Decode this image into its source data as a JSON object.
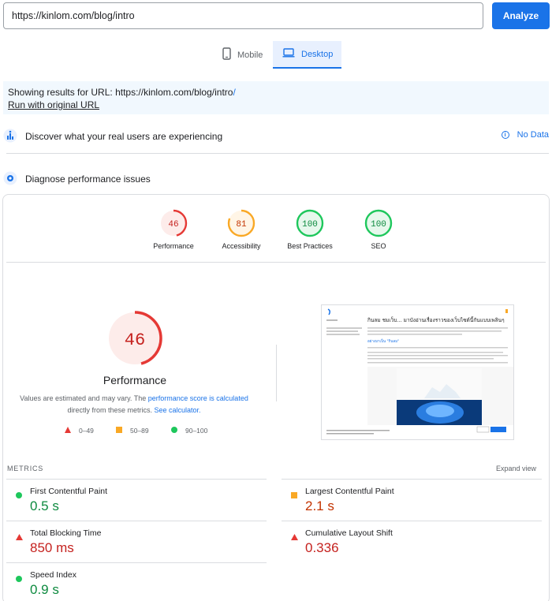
{
  "search": {
    "url": "https://kinlom.com/blog/intro",
    "analyze_label": "Analyze"
  },
  "tabs": [
    {
      "label": "Mobile",
      "icon": "phone-icon"
    },
    {
      "label": "Desktop",
      "icon": "laptop-icon",
      "selected": true
    }
  ],
  "notice": {
    "showing_prefix": "Showing results for URL: ",
    "url": "https://kinlom.com/blog/intro",
    "suffix": "/",
    "original_link": "Run with original URL"
  },
  "sections": {
    "real_users": {
      "label": "Discover what your real users are experiencing",
      "no_data": "No Data"
    },
    "diagnose": {
      "label": "Diagnose performance issues"
    }
  },
  "categories": [
    {
      "name": "Performance",
      "score": "46",
      "status": "bad"
    },
    {
      "name": "Accessibility",
      "score": "81",
      "status": "average"
    },
    {
      "name": "Best Practices",
      "score": "100",
      "status": "good"
    },
    {
      "name": "SEO",
      "score": "100",
      "status": "good"
    }
  ],
  "performance": {
    "score": "46",
    "title": "Performance",
    "estimate_text_1": "Values are estimated and may vary. The ",
    "estimate_link_1": "performance score is calculated",
    "estimate_text_2": "directly from these metrics. ",
    "estimate_link_2": "See calculator."
  },
  "legend": [
    {
      "range": "0–49",
      "shape": "triangle",
      "color": "#e53935"
    },
    {
      "range": "50–89",
      "shape": "square",
      "color": "#f9a825"
    },
    {
      "range": "90–100",
      "shape": "circle",
      "color": "#1ec75c"
    }
  ],
  "screenshot": {
    "heading": "กินลม ชมเว็บ... มาบังอ่านเรื่องราวของเว็บไซต์นี้กันแบบเพลินๆ",
    "subheading": "อย่างมาเป็น \"กินลม\""
  },
  "metrics": {
    "heading": "METRICS",
    "expand": "Expand view",
    "items": [
      {
        "name": "First Contentful Paint",
        "value": "0.5 s",
        "status": "good"
      },
      {
        "name": "Largest Contentful Paint",
        "value": "2.1 s",
        "status": "average"
      },
      {
        "name": "Total Blocking Time",
        "value": "850 ms",
        "status": "bad"
      },
      {
        "name": "Cumulative Layout Shift",
        "value": "0.336",
        "status": "bad"
      },
      {
        "name": "Speed Index",
        "value": "0.9 s",
        "status": "good"
      }
    ]
  },
  "colors": {
    "accent": "#1a73e8",
    "good": "#0d8a3f",
    "average": "#c33300",
    "bad": "#c5221f"
  }
}
